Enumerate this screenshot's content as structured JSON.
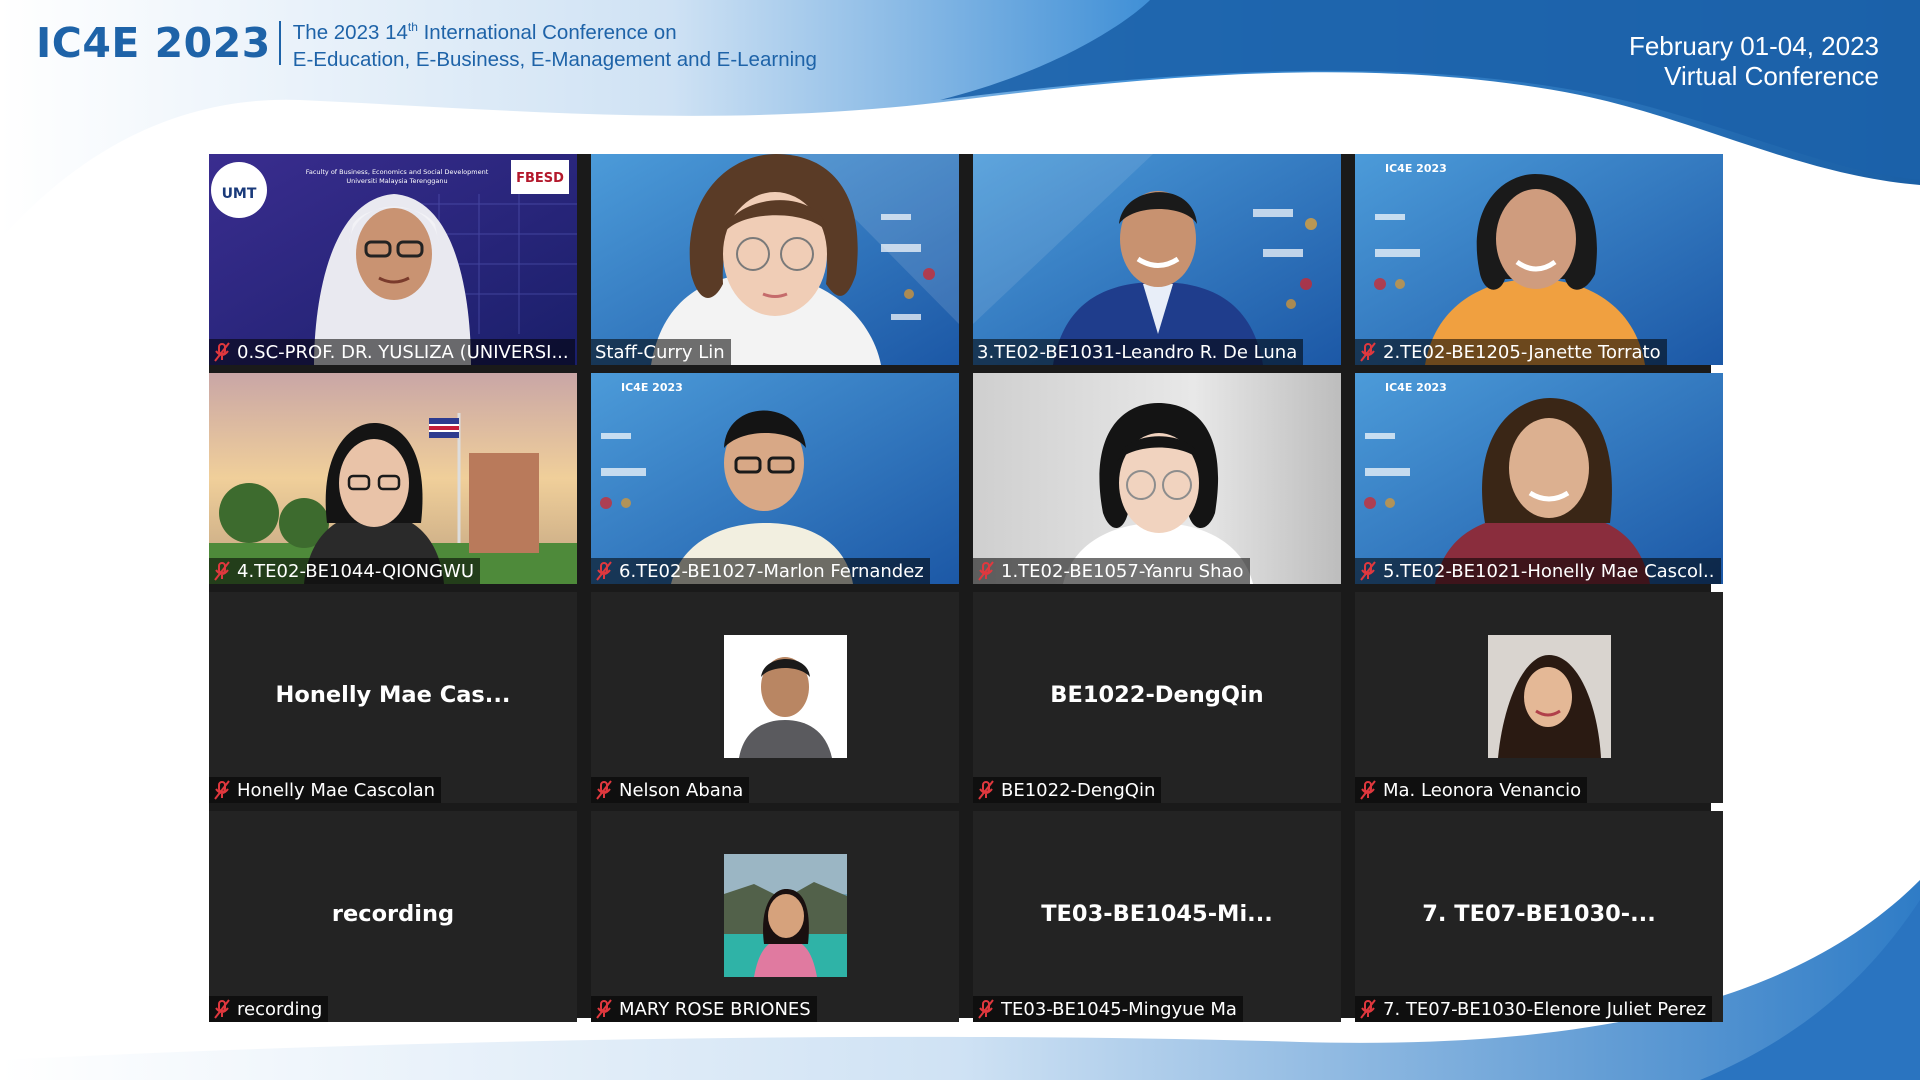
{
  "header": {
    "logo_text": "IC4E 2023",
    "title_line1_pre": "The 2023 14",
    "title_line1_sup": "th",
    "title_line1_post": " International Conference on",
    "title_line2": "E-Education, E-Business, E-Management and E-Learning",
    "date": "February 01-04, 2023",
    "venue": "Virtual Conference"
  },
  "colors": {
    "brand_blue": "#1e63a8",
    "active_speaker_border": "#f3ee74",
    "muted_mic_red": "#e0383e",
    "tile_background": "#232323"
  },
  "gallery": {
    "participants": [
      {
        "name": "0.SC-PROF. DR. YUSLIZA (UNIVERSI...",
        "muted": true,
        "video": "on"
      },
      {
        "name": "Staff-Curry Lin",
        "muted": false,
        "video": "on",
        "active_speaker": true
      },
      {
        "name": "3.TE02-BE1031-Leandro R. De Luna",
        "muted": false,
        "video": "on"
      },
      {
        "name": "2.TE02-BE1205-Janette Torrato",
        "muted": true,
        "video": "on"
      },
      {
        "name": "4.TE02-BE1044-QIONGWU",
        "muted": true,
        "video": "on"
      },
      {
        "name": "6.TE02-BE1027-Marlon Fernandez",
        "muted": true,
        "video": "on"
      },
      {
        "name": "1.TE02-BE1057-Yanru Shao",
        "muted": true,
        "video": "on"
      },
      {
        "name": "5.TE02-BE1021-Honelly Mae Cascol...",
        "muted": true,
        "video": "on"
      },
      {
        "name": "Honelly Mae Cascolan",
        "center_text": "Honelly Mae Cas...",
        "muted": true,
        "video": "off"
      },
      {
        "name": "Nelson Abana",
        "muted": true,
        "video": "off",
        "profile_photo": true
      },
      {
        "name": "BE1022-DengQin",
        "center_text": "BE1022-DengQin",
        "muted": true,
        "video": "off"
      },
      {
        "name": "Ma. Leonora Venancio",
        "muted": true,
        "video": "off",
        "profile_photo": true
      },
      {
        "name": "recording",
        "center_text": "recording",
        "muted": true,
        "video": "off"
      },
      {
        "name": "MARY ROSE BRIONES",
        "muted": true,
        "video": "off",
        "profile_photo": true
      },
      {
        "name": "TE03-BE1045-Mingyue Ma",
        "center_text": "TE03-BE1045-Mi...",
        "muted": true,
        "video": "off"
      },
      {
        "name": "7. TE07-BE1030-Elenore Juliet Perez",
        "center_text": "7. TE07-BE1030-...",
        "muted": true,
        "video": "off"
      }
    ],
    "tile0_background_text": {
      "org_line1": "Faculty of Business, Economics and Social Development",
      "org_line2": "Universiti Malaysia Terengganu",
      "logo_left": "UMT",
      "logo_right": "FBESD"
    }
  }
}
